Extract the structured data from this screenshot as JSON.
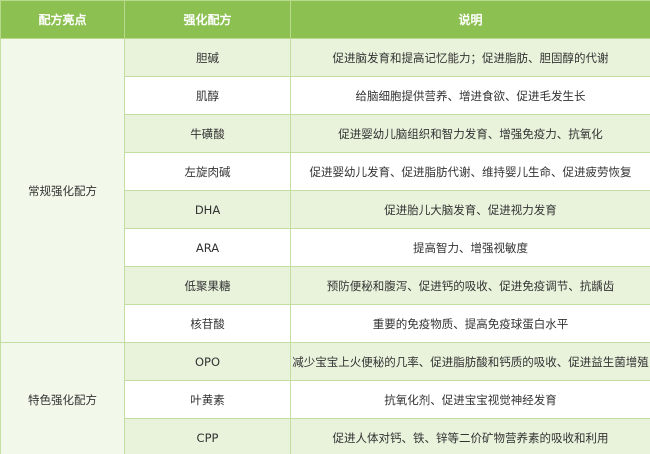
{
  "headers": [
    "配方亮点",
    "强化配方",
    "说明"
  ],
  "groups": [
    {
      "label": "常规强化配方",
      "rows": [
        {
          "name": "胆碱",
          "desc": "促进脑发育和提高记忆能力；促进脂肪、胆固醇的代谢"
        },
        {
          "name": "肌醇",
          "desc": "给脑细胞提供营养、增进食欲、促进毛发生长"
        },
        {
          "name": "牛磺酸",
          "desc": "促进婴幼儿脑组织和智力发育、增强免疫力、抗氧化"
        },
        {
          "name": "左旋肉碱",
          "desc": "促进婴幼儿发育、促进脂肪代谢、维持婴儿生命、促进疲劳恢复"
        },
        {
          "name": "DHA",
          "desc": "促进胎儿大脑发育、促进视力发育"
        },
        {
          "name": "ARA",
          "desc": "提高智力、增强视敏度"
        },
        {
          "name": "低聚果糖",
          "desc": "预防便秘和腹泻、促进钙的吸收、促进免疫调节、抗龋齿"
        },
        {
          "name": "核苷酸",
          "desc": "重要的免疫物质、提高免疫球蛋白水平"
        }
      ]
    },
    {
      "label": "特色强化配方",
      "rows": [
        {
          "name": "OPO",
          "desc": "减少宝宝上火便秘的几率、促进脂肪酸和钙质的吸收、促进益生菌增殖"
        },
        {
          "name": "叶黄素",
          "desc": "抗氧化剂、促进宝宝视觉神经发育"
        },
        {
          "name": "CPP",
          "desc": "促进人体对钙、铁、锌等二价矿物营养素的吸收和利用"
        }
      ]
    }
  ]
}
